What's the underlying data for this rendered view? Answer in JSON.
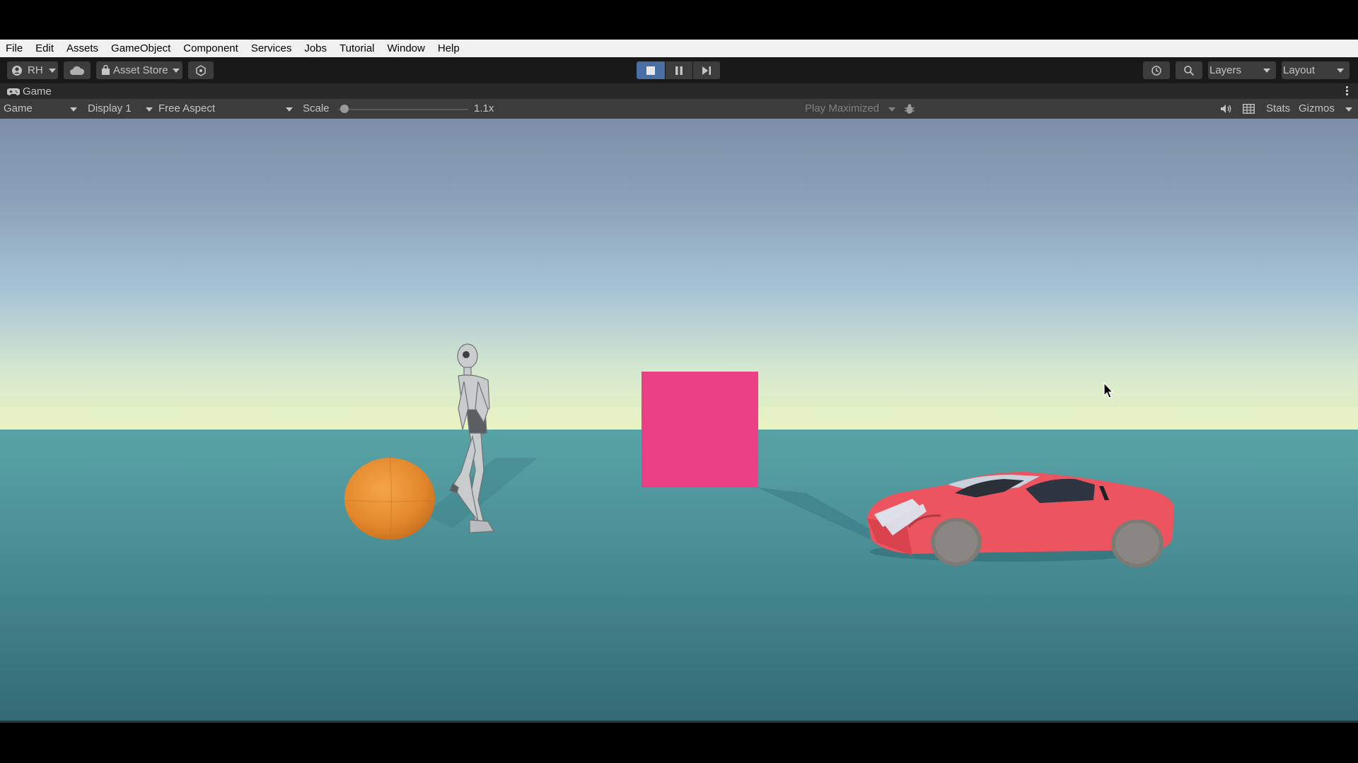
{
  "menu": [
    "File",
    "Edit",
    "Assets",
    "GameObject",
    "Component",
    "Services",
    "Jobs",
    "Tutorial",
    "Window",
    "Help"
  ],
  "toolbar": {
    "account_label": "RH",
    "asset_store_label": "Asset Store",
    "layers_label": "Layers",
    "layout_label": "Layout"
  },
  "game_tab": {
    "title": "Game"
  },
  "game_controls": {
    "view_mode": "Game",
    "display": "Display 1",
    "aspect": "Free Aspect",
    "scale_label": "Scale",
    "scale_value": "1.1x",
    "play_maximized": "Play Maximized",
    "stats_label": "Stats",
    "gizmos_label": "Gizmos"
  },
  "colors": {
    "cube": "#ea3f85",
    "sphere": "#e58a2d",
    "car_body": "#ec5560",
    "stop_button_active": "#4a6fa5"
  },
  "icons": [
    "account-icon",
    "cloud-icon",
    "shopping-bag-icon",
    "package-icon",
    "stop-icon",
    "pause-icon",
    "step-icon",
    "history-icon",
    "search-icon",
    "gamepad-icon",
    "more-icon",
    "bug-icon",
    "audio-icon",
    "grid-icon"
  ]
}
